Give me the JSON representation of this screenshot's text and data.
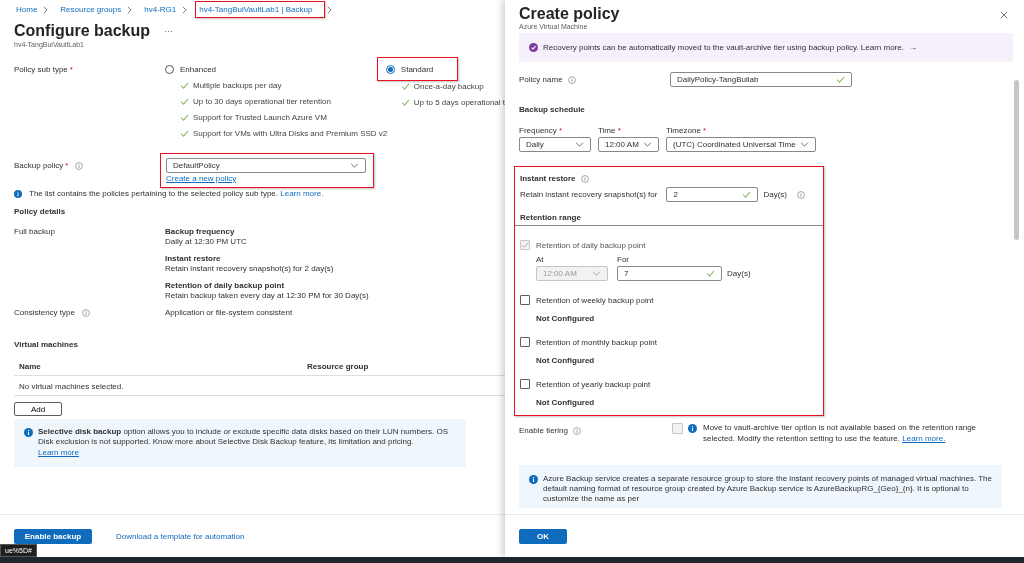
{
  "breadcrumb": [
    {
      "label": "Home",
      "highlighted": false
    },
    {
      "label": "Resource groups",
      "highlighted": false
    },
    {
      "label": "hv4-RG1",
      "highlighted": false
    },
    {
      "label": "hv4-TangBuiVaultLab1 | Backup",
      "highlighted": true
    }
  ],
  "page": {
    "title": "Configure backup",
    "more": "···",
    "subtitle": "hv4-TangBuiVaultLab1"
  },
  "policy_sub_type": {
    "label": "Policy sub type",
    "required": "*",
    "options": [
      {
        "label": "Enhanced",
        "selected": false,
        "highlighted": false,
        "features": [
          "Multiple backups per day",
          "Up to 30 days operational tier retention",
          "Support for Trusted Launch Azure VM",
          "Support for VMs with Ultra Disks and Premium SSD v2"
        ]
      },
      {
        "label": "Standard",
        "selected": true,
        "highlighted": true,
        "features": [
          "Once-a-day backup",
          "Up to 5 days operational t"
        ]
      }
    ]
  },
  "backup_policy": {
    "label": "Backup policy",
    "required": "*",
    "value": "DefaultPolicy",
    "link": "Create a new policy",
    "highlighted": true
  },
  "policy_note": {
    "text": "The list contains the policies pertaining to the selected policy sub type.",
    "link": "Learn more."
  },
  "policy_details": {
    "heading": "Policy details",
    "full_backup_label": "Full backup",
    "items": [
      {
        "title": "Backup frequency",
        "text": "Daily at 12:30 PM UTC"
      },
      {
        "title": "Instant restore",
        "text": "Retain instant recovery snapshot(s) for 2 day(s)"
      },
      {
        "title": "Retention of daily backup point",
        "text": "Retain backup taken every day at 12:30 PM for 30 Day(s)"
      }
    ],
    "consistency_label": "Consistency type",
    "consistency_value": "Application or file-system consistent"
  },
  "virtual_machines": {
    "heading": "Virtual machines",
    "columns": [
      "Name",
      "Resource group"
    ],
    "empty": "No virtual machines selected.",
    "add": "Add"
  },
  "disk_info": {
    "text": "**Selective disk backup** option allows you to include or exclude specific data disks based on their LUN numbers. OS Disk exclusion is not supported. Know more about Selective Disk Backup feature, its limitation and pricing.",
    "link": "Learn more"
  },
  "footer": {
    "primary": "Enable backup",
    "link": "Download a template for automation"
  },
  "status_url": "ue%5D#",
  "panel": {
    "title": "Create policy",
    "subtitle": "Azure Virtual Machine",
    "banner": {
      "text": "Recovery points can be automatically moved to the vault-archive tier using backup policy. Learn more.",
      "arrow": "→"
    },
    "policy_name": {
      "label": "Policy name",
      "value": "DailyPolicy-TangBuilab",
      "valid": true
    },
    "schedule": {
      "heading": "Backup schedule",
      "fields": [
        {
          "label": "Frequency",
          "required": "*",
          "value": "Daily"
        },
        {
          "label": "Time",
          "required": "*",
          "value": "12:00 AM"
        },
        {
          "label": "Timezone",
          "required": "*",
          "value": "(UTC) Coordinated Universal Time"
        }
      ]
    },
    "highlighted": true,
    "instant_restore": {
      "heading": "Instant restore",
      "label": "Retain instant recovery snapshot(s) for",
      "value": "2",
      "valid": true,
      "unit": "Day(s)"
    },
    "retention": {
      "heading": "Retention range",
      "items": [
        {
          "kind": "daily",
          "label": "Retention of daily backup point",
          "checked": true,
          "disabled": true,
          "at_label": "At",
          "at_value": "12:00 AM",
          "for_label": "For",
          "for_value": "7",
          "unit": "Day(s)"
        },
        {
          "kind": "summary",
          "label": "Retention of weekly backup point",
          "checked": false,
          "disabled": false,
          "status": "Not Configured"
        },
        {
          "kind": "summary",
          "label": "Retention of monthly backup point",
          "checked": false,
          "disabled": false,
          "status": "Not Configured"
        },
        {
          "kind": "summary",
          "label": "Retention of yearly backup point",
          "checked": false,
          "disabled": false,
          "status": "Not Configured"
        }
      ]
    },
    "tiering": {
      "label": "Enable tiering",
      "checked": false,
      "disabled": true,
      "text": "Move to vault-archive tier option is not available based on the retention range selected. Modify the retention setting to use the feature.",
      "link": "Learn more."
    },
    "rg_info": {
      "text": "Azure Backup service creates a separate resource group to store the instant recovery points of managed virtual machines. The default naming format of resource group created by Azure Backup service is AzureBackupRG_{Geo}_{n}. It is optional to customize the name as per"
    },
    "ok": "OK"
  }
}
